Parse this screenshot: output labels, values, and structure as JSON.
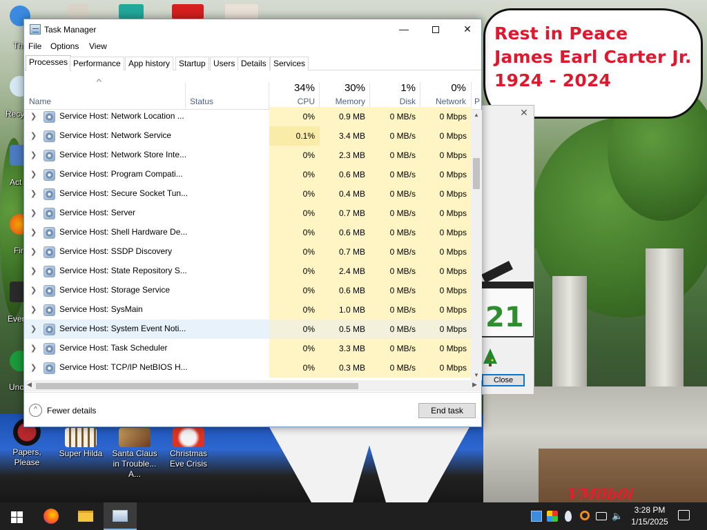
{
  "desktop": {
    "bubble_lines": [
      "Rest in Peace",
      "James Earl Carter Jr.",
      "1924 - 2024"
    ],
    "edge_labels": [
      "Th",
      "Recy",
      "Act",
      "Fir",
      "Ever",
      "Unc"
    ],
    "icons": [
      {
        "label": "Papers, Please"
      },
      {
        "label": "Super Hilda"
      },
      {
        "label": "Santa Claus in Trouble... A..."
      },
      {
        "label": "Christmas Eve Crisis"
      }
    ],
    "bg_dialog_close": "Close",
    "watermark": "VM0b0i"
  },
  "window": {
    "title": "Task Manager",
    "menu": [
      "File",
      "Options",
      "View"
    ],
    "tabs": [
      "Processes",
      "Performance",
      "App history",
      "Startup",
      "Users",
      "Details",
      "Services"
    ],
    "active_tab": "Processes",
    "columns": {
      "name": "Name",
      "status": "Status",
      "cpu": {
        "pct": "34%",
        "label": "CPU"
      },
      "memory": {
        "pct": "30%",
        "label": "Memory"
      },
      "disk": {
        "pct": "1%",
        "label": "Disk"
      },
      "network": {
        "pct": "0%",
        "label": "Network"
      },
      "overflow": "P"
    },
    "rows": [
      {
        "name": "Service Host: Network Location ...",
        "cpu": "0%",
        "mem": "0.9 MB",
        "disk": "0 MB/s",
        "net": "0 Mbps"
      },
      {
        "name": "Service Host: Network Service",
        "cpu": "0.1%",
        "mem": "3.4 MB",
        "disk": "0 MB/s",
        "net": "0 Mbps"
      },
      {
        "name": "Service Host: Network Store Inte...",
        "cpu": "0%",
        "mem": "2.3 MB",
        "disk": "0 MB/s",
        "net": "0 Mbps"
      },
      {
        "name": "Service Host: Program Compati...",
        "cpu": "0%",
        "mem": "0.6 MB",
        "disk": "0 MB/s",
        "net": "0 Mbps"
      },
      {
        "name": "Service Host: Secure Socket Tun...",
        "cpu": "0%",
        "mem": "0.4 MB",
        "disk": "0 MB/s",
        "net": "0 Mbps"
      },
      {
        "name": "Service Host: Server",
        "cpu": "0%",
        "mem": "0.7 MB",
        "disk": "0 MB/s",
        "net": "0 Mbps"
      },
      {
        "name": "Service Host: Shell Hardware De...",
        "cpu": "0%",
        "mem": "0.6 MB",
        "disk": "0 MB/s",
        "net": "0 Mbps"
      },
      {
        "name": "Service Host: SSDP Discovery",
        "cpu": "0%",
        "mem": "0.7 MB",
        "disk": "0 MB/s",
        "net": "0 Mbps"
      },
      {
        "name": "Service Host: State Repository S...",
        "cpu": "0%",
        "mem": "2.4 MB",
        "disk": "0 MB/s",
        "net": "0 Mbps"
      },
      {
        "name": "Service Host: Storage Service",
        "cpu": "0%",
        "mem": "0.6 MB",
        "disk": "0 MB/s",
        "net": "0 Mbps"
      },
      {
        "name": "Service Host: SysMain",
        "cpu": "0%",
        "mem": "1.0 MB",
        "disk": "0 MB/s",
        "net": "0 Mbps"
      },
      {
        "name": "Service Host: System Event Noti...",
        "cpu": "0%",
        "mem": "0.5 MB",
        "disk": "0 MB/s",
        "net": "0 Mbps"
      },
      {
        "name": "Service Host: Task Scheduler",
        "cpu": "0%",
        "mem": "3.3 MB",
        "disk": "0 MB/s",
        "net": "0 Mbps"
      },
      {
        "name": "Service Host: TCP/IP NetBIOS H...",
        "cpu": "0%",
        "mem": "0.3 MB",
        "disk": "0 MB/s",
        "net": "0 Mbps"
      }
    ],
    "footer": {
      "fewer_details": "Fewer details",
      "end_task": "End task"
    }
  },
  "taskbar": {
    "time": "3:28 PM",
    "date": "1/15/2025",
    "apps": [
      "windows-start-icon",
      "firefox-icon",
      "file-explorer-icon",
      "task-manager-icon"
    ]
  }
}
